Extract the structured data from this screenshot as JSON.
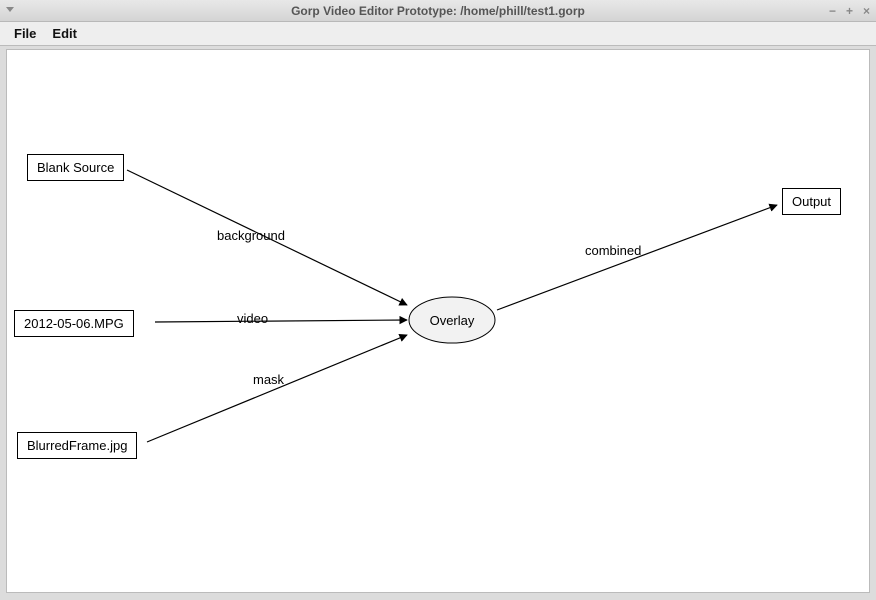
{
  "window": {
    "title": "Gorp Video Editor Prototype: /home/phill/test1.gorp"
  },
  "menubar": {
    "file": "File",
    "edit": "Edit"
  },
  "nodes": {
    "blank_source": "Blank Source",
    "mpg": "2012-05-06.MPG",
    "blurred": "BlurredFrame.jpg",
    "overlay": "Overlay",
    "output": "Output"
  },
  "edges": {
    "background": "background",
    "video": "video",
    "mask": "mask",
    "combined": "combined"
  }
}
